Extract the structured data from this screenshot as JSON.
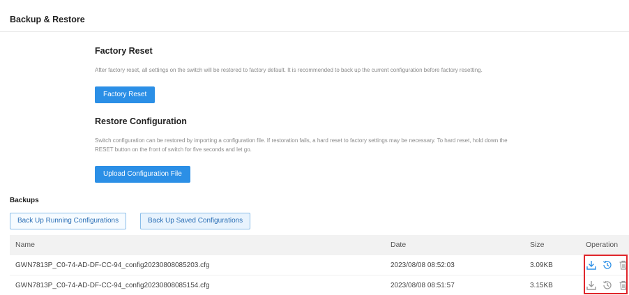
{
  "header": {
    "title": "Backup & Restore"
  },
  "factory_reset": {
    "title": "Factory Reset",
    "description": "After factory reset, all settings on the switch will be restored to factory default. It is recommended to back up the current configuration before factory resetting.",
    "button_label": "Factory Reset"
  },
  "restore": {
    "title": "Restore Configuration",
    "description_line1": "Switch configuration can be restored by importing a configuration file. If restoration fails, a hard reset to factory settings may be necessary. To hard reset, hold down the",
    "description_line2": "RESET button on the front of switch for five seconds and let go.",
    "button_label": "Upload Configuration File"
  },
  "backups": {
    "title": "Backups",
    "btn_running": "Back Up Running Configurations",
    "btn_saved": "Back Up Saved Configurations",
    "columns": {
      "name": "Name",
      "date": "Date",
      "size": "Size",
      "operation": "Operation"
    },
    "rows": [
      {
        "name": "GWN7813P_C0-74-AD-DF-CC-94_config20230808085203.cfg",
        "date": "2023/08/08 08:52:03",
        "size": "3.09KB"
      },
      {
        "name": "GWN7813P_C0-74-AD-DF-CC-94_config20230808085154.cfg",
        "date": "2023/08/08 08:51:57",
        "size": "3.15KB"
      }
    ],
    "operation_icons": [
      "download-icon",
      "restore-history-icon",
      "trash-icon"
    ]
  },
  "colors": {
    "accent": "#2b8fe6",
    "icon_active": "#2b8fe6",
    "icon_inactive": "#9a9a9a",
    "highlight": "#e0262b"
  }
}
